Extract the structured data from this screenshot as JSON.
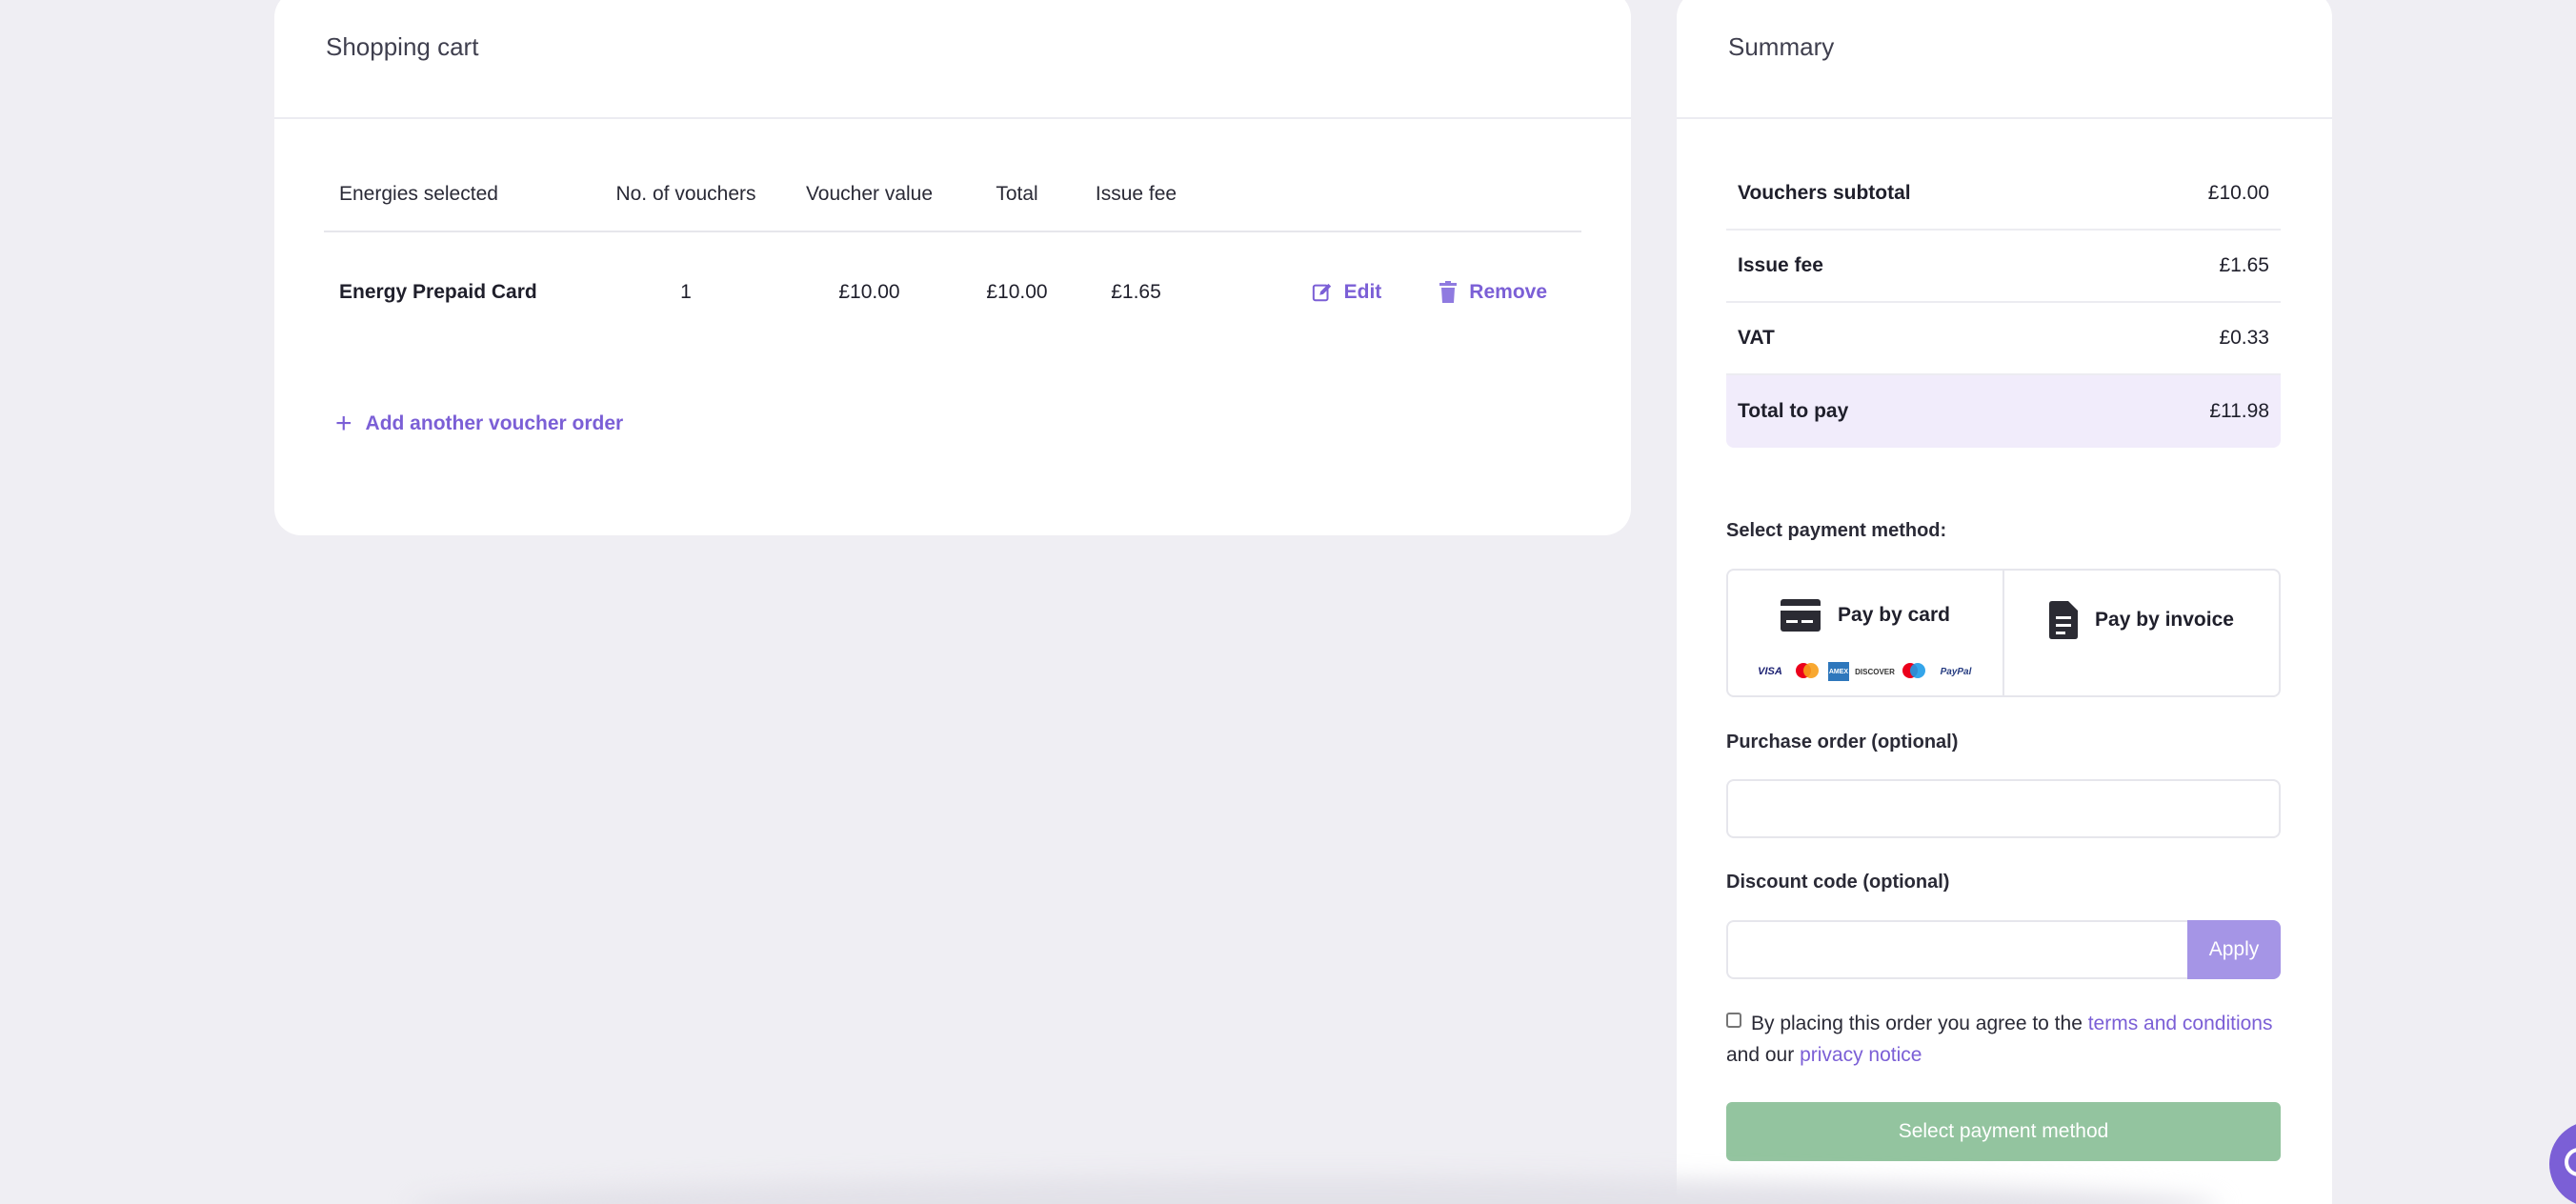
{
  "cart": {
    "title": "Shopping cart",
    "columns": [
      "Energies selected",
      "No. of vouchers",
      "Voucher value",
      "Total",
      "Issue fee"
    ],
    "rows": [
      {
        "name": "Energy Prepaid Card",
        "vouchers": "1",
        "value": "£10.00",
        "total": "£10.00",
        "fee": "£1.65",
        "edit": "Edit",
        "remove": "Remove"
      }
    ],
    "add_order": "Add another voucher order"
  },
  "summary": {
    "title": "Summary",
    "lines": [
      {
        "label": "Vouchers subtotal",
        "value": "£10.00"
      },
      {
        "label": "Issue fee",
        "value": "£1.65"
      },
      {
        "label": "VAT",
        "value": "£0.33"
      },
      {
        "label": "Total to pay",
        "value": "£11.98"
      }
    ],
    "payment_label": "Select payment method:",
    "pay_card": "Pay by card",
    "pay_invoice": "Pay by invoice",
    "card_brands": [
      "VISA",
      "Mastercard",
      "AMEX",
      "DISCOVER",
      "Maestro",
      "PayPal"
    ],
    "purchase_order_label": "Purchase order (optional)",
    "purchase_order_value": "",
    "discount_label": "Discount code (optional)",
    "discount_value": "",
    "apply": "Apply",
    "terms_prefix": "By placing this order you agree to the ",
    "terms_link": "terms and conditions",
    "terms_mid": " and our ",
    "privacy_link": "privacy notice",
    "cta": "Select payment method"
  },
  "colors": {
    "accent": "#7b5fd6",
    "cta_disabled": "#93c49f",
    "total_bg": "#f1ecfb",
    "background": "#efeef3"
  },
  "icons": [
    "edit-icon",
    "trash-icon",
    "plus-icon",
    "credit-card-icon",
    "invoice-icon",
    "chat-icon"
  ]
}
